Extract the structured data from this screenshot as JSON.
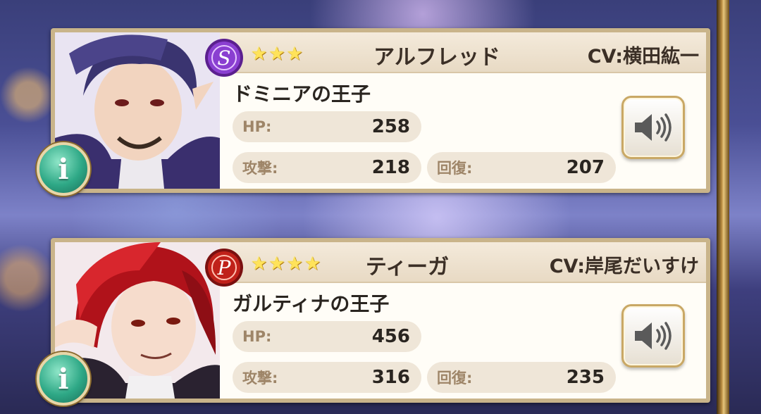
{
  "characters": [
    {
      "type_letter": "S",
      "type_color": "#8a3fd1",
      "stars": [
        "★",
        "★",
        "★"
      ],
      "name": "アルフレッド",
      "cv": "CV:横田紘一",
      "title": "ドミニアの王子",
      "hp_label": "HP:",
      "hp_value": "258",
      "atk_label": "攻撃:",
      "atk_value": "218",
      "rec_label": "回復:",
      "rec_value": "207",
      "info_label": "i",
      "hair_color": "#3a3470"
    },
    {
      "type_letter": "P",
      "type_color": "#c0211a",
      "stars": [
        "★",
        "★",
        "★",
        "★"
      ],
      "name": "ティーガ",
      "cv": "CV:岸尾だいすけ",
      "title": "ガルティナの王子",
      "hp_label": "HP:",
      "hp_value": "456",
      "atk_label": "攻撃:",
      "atk_value": "316",
      "rec_label": "回復:",
      "rec_value": "235",
      "info_label": "i",
      "hair_color": "#b0121a"
    }
  ]
}
